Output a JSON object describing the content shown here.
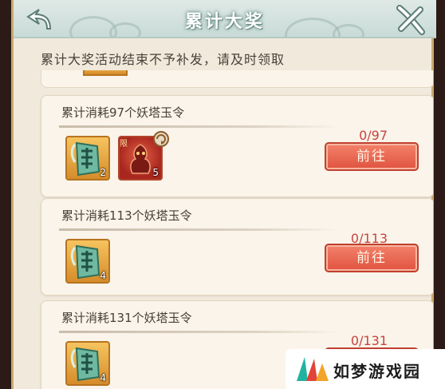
{
  "header": {
    "title": "累计大奖"
  },
  "notice": "累计大奖活动结束不予补发，请及时领取",
  "rewards": [
    {
      "title": "累计消耗97个妖塔玉令",
      "progress": "0/97",
      "button": "前往",
      "items": [
        {
          "icon": "jade-token-icon",
          "qty": "2"
        },
        {
          "icon": "red-demon-icon",
          "qty": "5",
          "tag": "限"
        }
      ]
    },
    {
      "title": "累计消耗113个妖塔玉令",
      "progress": "0/113",
      "button": "前往",
      "items": [
        {
          "icon": "jade-token-icon",
          "qty": "4"
        }
      ]
    },
    {
      "title": "累计消耗131个妖塔玉令",
      "progress": "0/131",
      "button": "前往",
      "items": [
        {
          "icon": "jade-token-icon",
          "qty": "4"
        }
      ]
    }
  ],
  "watermark": {
    "text": "如梦游戏园"
  },
  "colors": {
    "accent": "#e0533f",
    "progress_text": "#c9433e",
    "header": "#c9dbd7",
    "panel": "#f1e9dc"
  }
}
